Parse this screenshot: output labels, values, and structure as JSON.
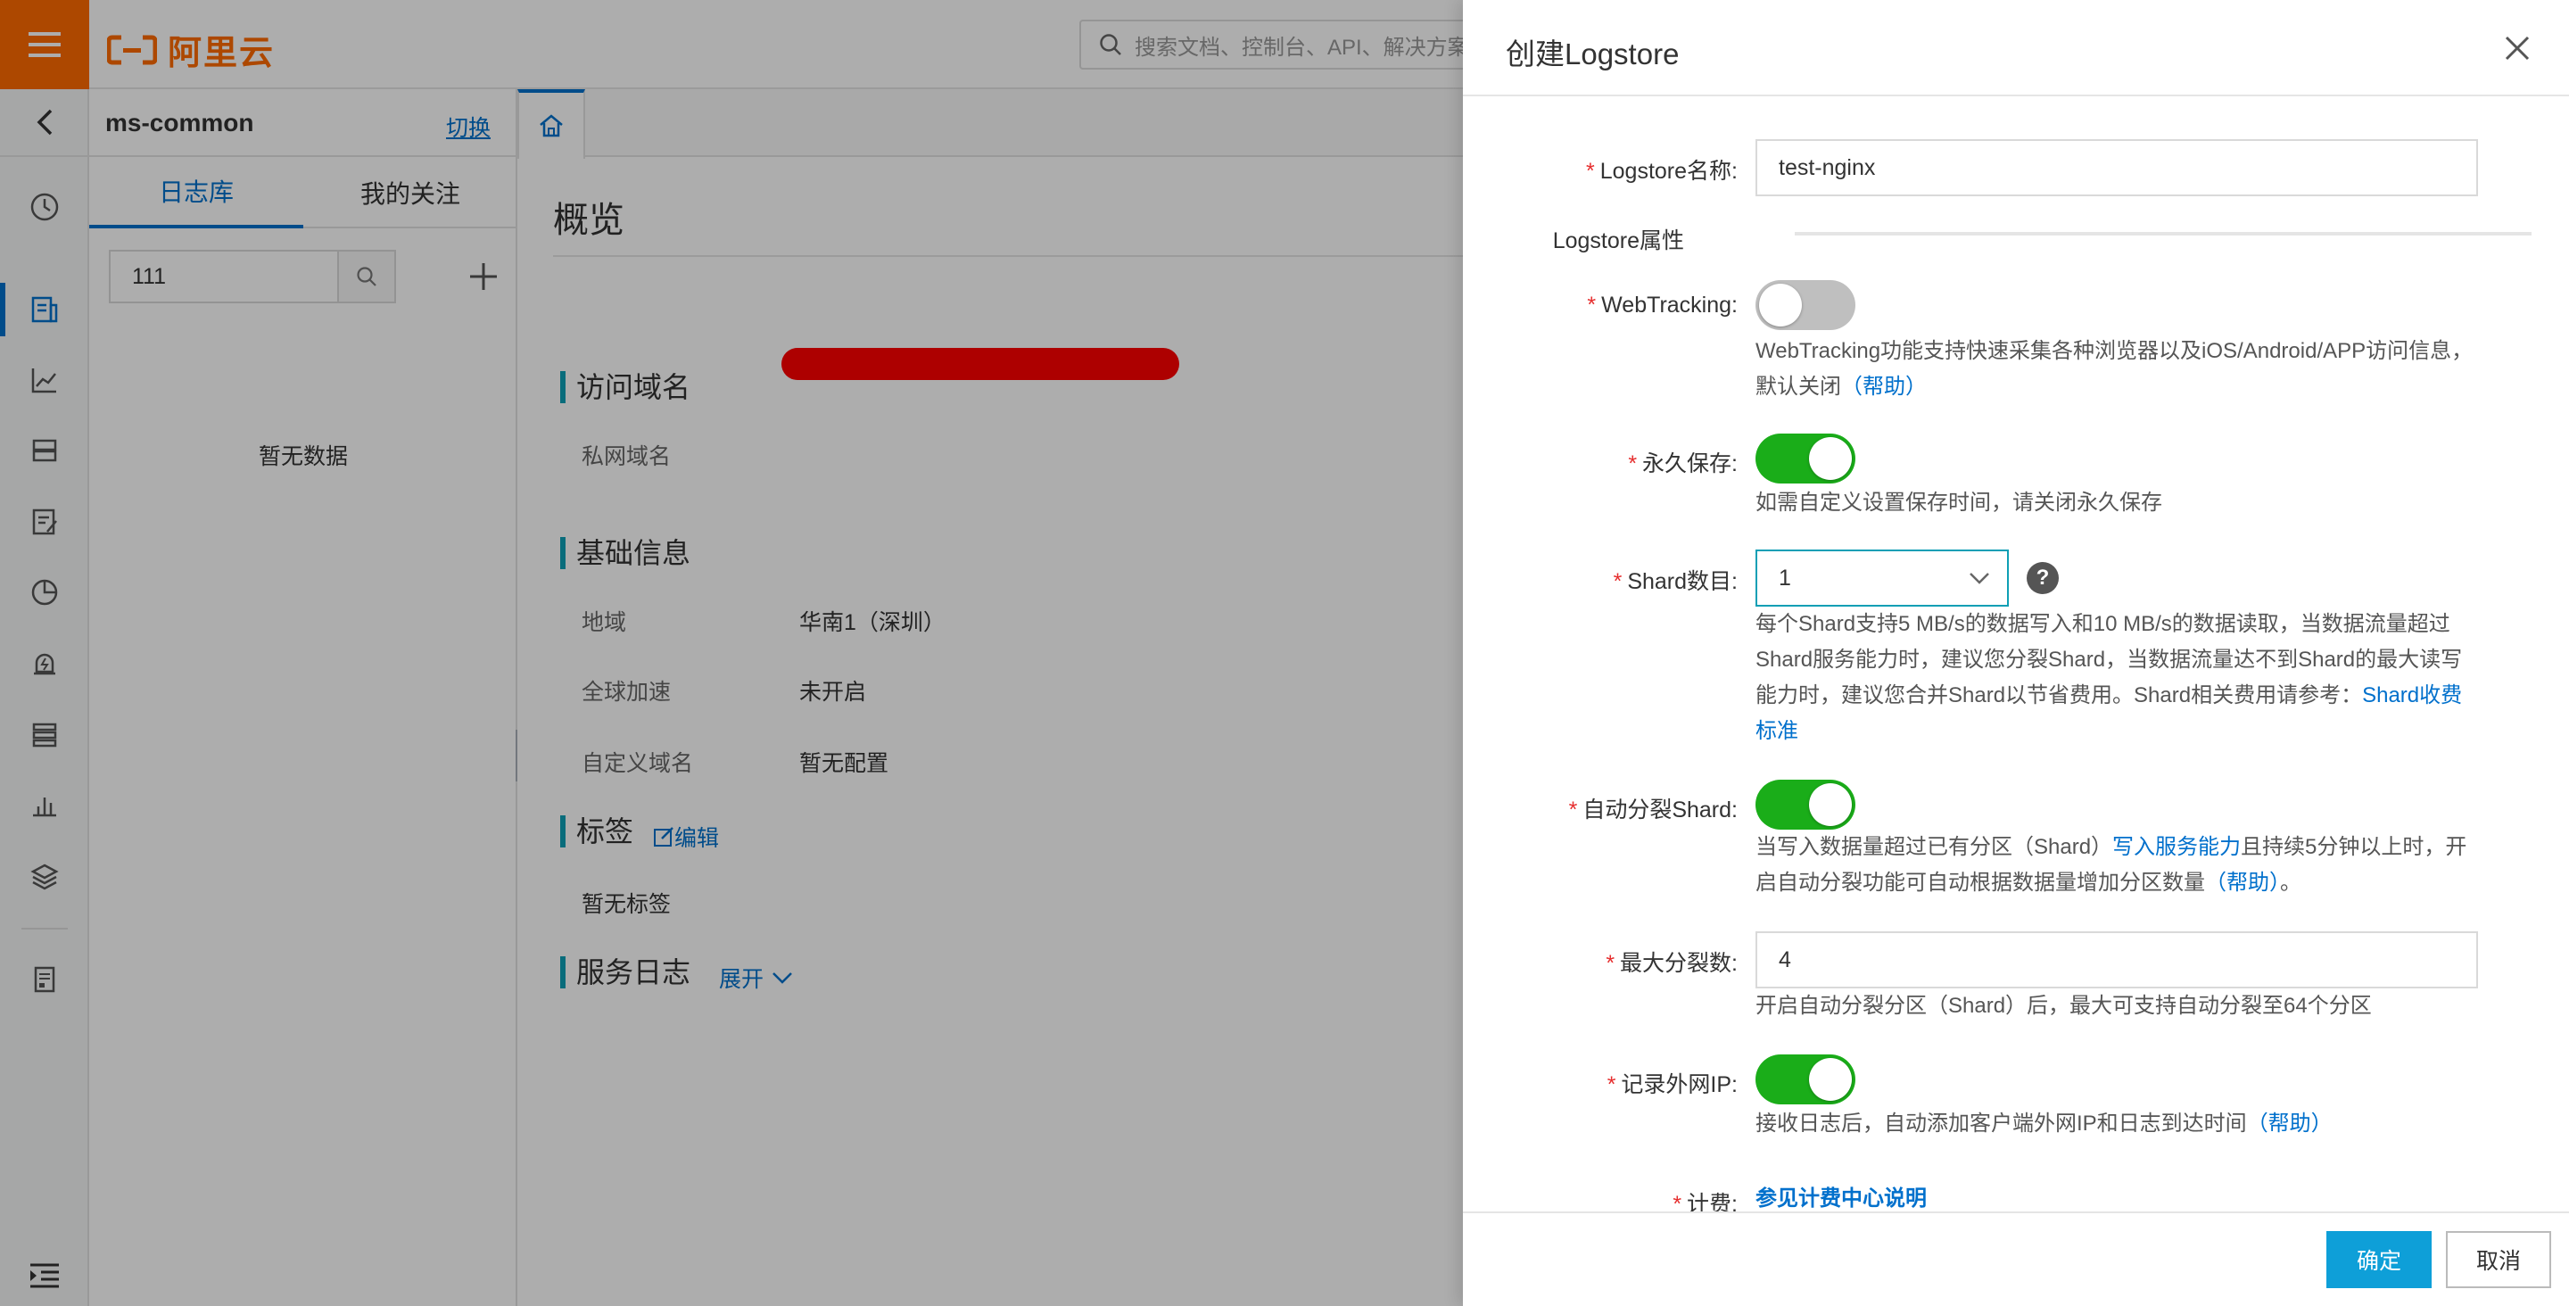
{
  "brand": {
    "logo_text": "阿里云",
    "accent": "#ff6a00"
  },
  "topbar": {
    "search_placeholder": "搜索文档、控制台、API、解决方案"
  },
  "project": {
    "name": "ms-common",
    "switch_label": "切换",
    "tabs": [
      {
        "label": "日志库"
      },
      {
        "label": "我的关注"
      }
    ],
    "search_value": "111",
    "empty_text": "暂无数据"
  },
  "rail": {
    "icons": [
      "clock-icon",
      "logstore-icon",
      "chart-icon",
      "storage-icon",
      "report-icon",
      "pie-chart-icon",
      "alert-icon",
      "list-icon",
      "dashboard-icon",
      "layers-icon",
      "document-icon",
      "menu-fold-icon"
    ]
  },
  "overview": {
    "title": "概览",
    "sections": {
      "domain": {
        "title": "访问域名",
        "private_label": "私网域名"
      },
      "basic": {
        "title": "基础信息",
        "rows": [
          {
            "label": "地域",
            "value": "华南1（深圳）"
          },
          {
            "label": "全球加速",
            "value": "未开启"
          },
          {
            "label": "自定义域名",
            "value": "暂无配置"
          }
        ]
      },
      "tags": {
        "title": "标签",
        "edit_label": "编辑",
        "empty": "暂无标签"
      },
      "service_log": {
        "title": "服务日志",
        "expand_label": "展开"
      }
    }
  },
  "drawer": {
    "title": "创建Logstore",
    "fields": {
      "name": {
        "label": "Logstore名称:",
        "value": "test-nginx"
      },
      "props_label": "Logstore属性",
      "webtracking": {
        "label": "WebTracking:",
        "on": false,
        "help": "WebTracking功能支持快速采集各种浏览器以及iOS/Android/APP访问信息，",
        "help2": "默认关闭",
        "help_link": "（帮助）"
      },
      "permanent": {
        "label": "永久保存:",
        "on": true,
        "help": "如需自定义设置保存时间，请关闭永久保存"
      },
      "shard": {
        "label": "Shard数目:",
        "value": "1",
        "help_l1": "每个Shard支持5 MB/s的数据写入和10 MB/s的数据读取，当数据流量超过",
        "help_l2": "Shard服务能力时，建议您分裂Shard，当数据流量达不到Shard的最大读写",
        "help_l3": "能力时，建议您合并Shard以节省费用。Shard相关费用请参考：",
        "help_link1": "Shard收费",
        "help_link2": "标准"
      },
      "auto_split": {
        "label": "自动分裂Shard:",
        "on": true,
        "help_a": "当写入数据量超过已有分区（Shard）",
        "help_link": "写入服务能力",
        "help_b": "且持续5分钟以上时，开",
        "help_c": "启自动分裂功能可自动根据数据量增加分区数量",
        "help_link2": "（帮助）",
        "help_d": "。"
      },
      "max_split": {
        "label": "最大分裂数:",
        "value": "4",
        "help": "开启自动分裂分区（Shard）后，最大可支持自动分裂至64个分区"
      },
      "record_ip": {
        "label": "记录外网IP:",
        "on": true,
        "help": "接收日志后，自动添加客户端外网IP和日志到达时间",
        "help_link": "（帮助）"
      },
      "billing": {
        "label": "计费:",
        "link": "参见计费中心说明"
      }
    },
    "confirm_label": "确定",
    "cancel_label": "取消",
    "colors": {
      "primary": "#0e9fd8",
      "toggle_on": "#1aad19",
      "link": "#0070cc"
    }
  }
}
